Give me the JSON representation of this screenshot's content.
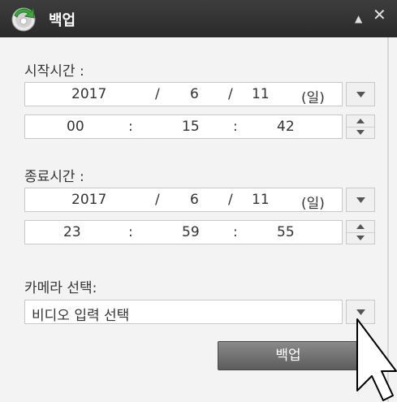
{
  "window": {
    "title": "백업"
  },
  "start": {
    "label": "시작시간 :",
    "date": {
      "year": "2017",
      "sep": "/",
      "month": "6",
      "day": "11",
      "weekday": "(일)"
    },
    "time": {
      "hour": "00",
      "sep": ":",
      "minute": "15",
      "second": "42"
    }
  },
  "end": {
    "label": "종료시간 :",
    "date": {
      "year": "2017",
      "sep": "/",
      "month": "6",
      "day": "11",
      "weekday": "(일)"
    },
    "time": {
      "hour": "23",
      "sep": ":",
      "minute": "59",
      "second": "55"
    }
  },
  "camera": {
    "label": "카메라 선택:",
    "selected": "비디오 입력 선택"
  },
  "actions": {
    "backup_label": "백업"
  },
  "icons": {
    "app": "backup-refresh-icon",
    "minimize": "minimize-icon",
    "close": "close-icon",
    "dropdown": "chevron-down-icon",
    "spinner": "spinner-icon"
  }
}
